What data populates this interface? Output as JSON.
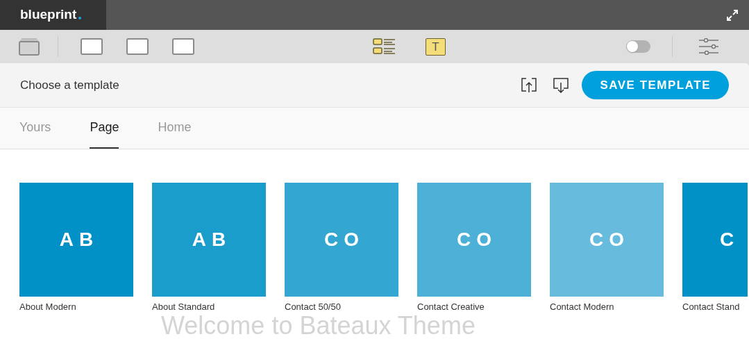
{
  "app": {
    "logo": "blueprint",
    "toggle": {
      "on": false
    },
    "text_tool": "T"
  },
  "panel": {
    "title": "Choose a template",
    "save_button": "SAVE TEMPLATE"
  },
  "tabs": [
    {
      "label": "Yours",
      "selected": false
    },
    {
      "label": "Page",
      "selected": true
    },
    {
      "label": "Home",
      "selected": false
    }
  ],
  "templates": [
    {
      "initials": "AB",
      "name": "About Modern",
      "color": "#0291c7"
    },
    {
      "initials": "AB",
      "name": "About Standard",
      "color": "#1b9dcc"
    },
    {
      "initials": "CO",
      "name": "Contact 50/50",
      "color": "#34a6d2"
    },
    {
      "initials": "CO",
      "name": "Contact Creative",
      "color": "#4db1d7"
    },
    {
      "initials": "CO",
      "name": "Contact Modern",
      "color": "#67bcdd"
    },
    {
      "initials": "C",
      "name": "Contact Stand",
      "color": "#0291c7"
    }
  ],
  "background_heading": "Welcome to Bateaux Theme"
}
